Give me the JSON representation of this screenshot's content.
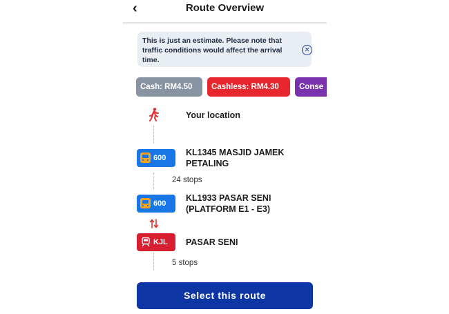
{
  "header": {
    "back_icon": "chevron-left-icon",
    "title": "Route Overview"
  },
  "notice": {
    "text": "This is just an estimate. Please note that traffic conditions would affect the arrival time.",
    "close_icon": "close-circle-icon"
  },
  "fares": [
    {
      "label": "Cash: RM4.50",
      "color": "#8994a3"
    },
    {
      "label": "Cashless: RM4.30",
      "color": "#e8262d"
    },
    {
      "label": "Conse",
      "color": "#7b33ad"
    }
  ],
  "route": {
    "origin": {
      "icon": "walking-icon",
      "label": "Your location"
    },
    "legs": [
      {
        "mode": "bus",
        "icon": "bus-icon",
        "line": "600",
        "color": "#1876e6",
        "from": "KL1345 MASJID JAMEK PETALING",
        "stops": "24 stops"
      },
      {
        "mode": "bus",
        "icon": "bus-icon",
        "line": "600",
        "color": "#1876e6",
        "from": "KL1933 PASAR SENI (PLATFORM E1 - E3)"
      },
      {
        "mode": "rail",
        "icon": "train-icon",
        "line": "KJL",
        "color": "#d81e31",
        "from": "PASAR SENI",
        "stops": "5 stops"
      }
    ],
    "transfer_icon": "transfer-arrows-icon"
  },
  "cta": {
    "label": "Select this route",
    "color": "#0d35a3"
  }
}
